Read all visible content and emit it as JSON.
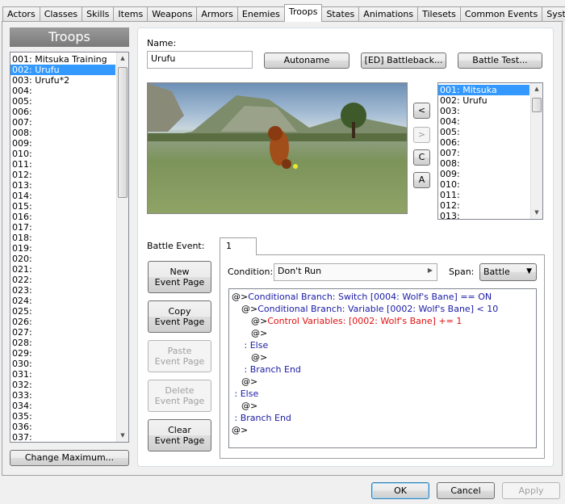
{
  "tabs": [
    "Actors",
    "Classes",
    "Skills",
    "Items",
    "Weapons",
    "Armors",
    "Enemies",
    "Troops",
    "States",
    "Animations",
    "Tilesets",
    "Common Events",
    "System"
  ],
  "active_tab": "Troops",
  "troops_header": "Troops",
  "troop_list": [
    "001: Mitsuka Training",
    "002: Urufu",
    "003: Urufu*2",
    "004:",
    "005:",
    "006:",
    "007:",
    "008:",
    "009:",
    "010:",
    "011:",
    "012:",
    "013:",
    "014:",
    "015:",
    "016:",
    "017:",
    "018:",
    "019:",
    "020:",
    "021:",
    "022:",
    "023:",
    "024:",
    "025:",
    "026:",
    "027:",
    "028:",
    "029:",
    "030:",
    "031:",
    "032:",
    "033:",
    "034:",
    "035:",
    "036:",
    "037:"
  ],
  "selected_troop": "002: Urufu",
  "change_maximum": "Change Maximum...",
  "name_label": "Name:",
  "name_value": "Urufu",
  "autoname": "Autoname",
  "battleback": "[ED] Battleback...",
  "battle_test": "Battle Test...",
  "arrow_buttons": [
    "<",
    ">",
    "C",
    "A"
  ],
  "enemy_list": [
    "001: Mitsuka",
    "002: Urufu",
    "003:",
    "004:",
    "005:",
    "006:",
    "007:",
    "008:",
    "009:",
    "010:",
    "011:",
    "012:",
    "013:"
  ],
  "selected_enemy": "001: Mitsuka",
  "battle_event_label": "Battle Event:",
  "event_tab": "1",
  "page_buttons": [
    {
      "l1": "New",
      "l2": "Event Page",
      "enabled": true
    },
    {
      "l1": "Copy",
      "l2": "Event Page",
      "enabled": true
    },
    {
      "l1": "Paste",
      "l2": "Event Page",
      "enabled": false
    },
    {
      "l1": "Delete",
      "l2": "Event Page",
      "enabled": false
    },
    {
      "l1": "Clear",
      "l2": "Event Page",
      "enabled": true
    }
  ],
  "condition_label": "Condition:",
  "condition_value": "Don't Run",
  "span_label": "Span:",
  "span_value": "Battle",
  "event_lines": [
    {
      "indent": 0,
      "prefix": "@>",
      "text": "Conditional Branch: Switch [0004: Wolf's Bane] == ON",
      "color": "blue"
    },
    {
      "indent": 1,
      "prefix": "@>",
      "text": "Conditional Branch: Variable [0002: Wolf's Bane] < 10",
      "color": "blue"
    },
    {
      "indent": 2,
      "prefix": "@>",
      "text": "Control Variables: [0002: Wolf's Bane] += 1",
      "color": "red"
    },
    {
      "indent": 2,
      "prefix": "@>",
      "text": "",
      "color": "blue"
    },
    {
      "indent": 1,
      "prefix": " : ",
      "text": "Else",
      "color": "blue"
    },
    {
      "indent": 2,
      "prefix": "@>",
      "text": "",
      "color": "blue"
    },
    {
      "indent": 1,
      "prefix": " : ",
      "text": "Branch End",
      "color": "blue"
    },
    {
      "indent": 1,
      "prefix": "@>",
      "text": "",
      "color": "blue"
    },
    {
      "indent": 0,
      "prefix": " : ",
      "text": "Else",
      "color": "blue"
    },
    {
      "indent": 1,
      "prefix": "@>",
      "text": "",
      "color": "blue"
    },
    {
      "indent": 0,
      "prefix": " : ",
      "text": "Branch End",
      "color": "blue"
    },
    {
      "indent": 0,
      "prefix": "@>",
      "text": "",
      "color": "blue"
    }
  ],
  "ok": "OK",
  "cancel": "Cancel",
  "apply": "Apply"
}
